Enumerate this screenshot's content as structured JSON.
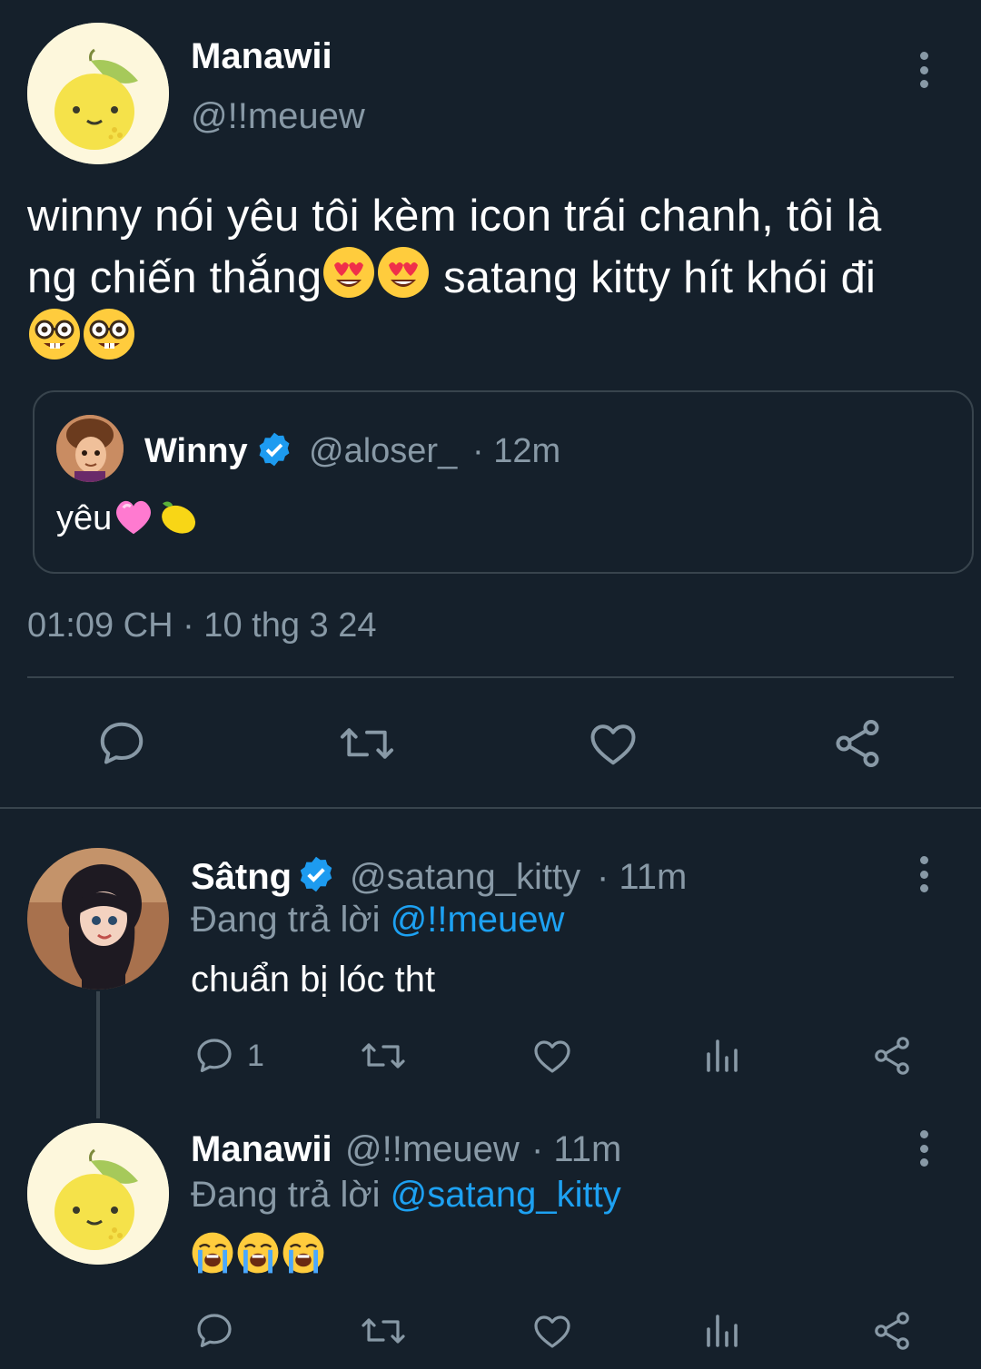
{
  "main_tweet": {
    "author_name": "Manawii",
    "author_handle": "@!!meuew",
    "text_line1": "winny nói yêu tôi kèm icon trái chanh, tôi là",
    "text_line2a": "ng chiến thắng",
    "text_line2b": " satang kitty hít khói đi",
    "timestamp": "01:09 CH · 10 thg 3 24",
    "avatar_icon": "lemon-avatar-icon",
    "emojis": [
      "heart-eyes-emoji",
      "heart-eyes-emoji",
      "nerd-face-emoji",
      "nerd-face-emoji"
    ]
  },
  "quoted_tweet": {
    "author_name": "Winny",
    "author_handle": "@aloser_",
    "time": "· 12m",
    "text": "yêu",
    "emojis": [
      "pink-heart-emoji",
      "lemon-emoji"
    ]
  },
  "actions": {
    "reply_icon": "reply-icon",
    "retweet_icon": "retweet-icon",
    "like_icon": "heart-icon",
    "share_icon": "share-icon",
    "views_icon": "bar-chart-icon"
  },
  "replies": [
    {
      "author_name": "Sâtng",
      "author_handle": "@satang_kitty",
      "time": "· 11m",
      "replying_prefix": "Đang trả lời ",
      "replying_to": "@!!meuew",
      "text": "chuẩn bị lóc tht",
      "reply_count": "1"
    },
    {
      "author_name": "Manawii",
      "author_handle": "@!!meuew",
      "time": "· 11m",
      "replying_prefix": "Đang trả lời ",
      "replying_to": "@satang_kitty",
      "text": "",
      "emojis": [
        "loudly-crying-emoji",
        "loudly-crying-emoji",
        "loudly-crying-emoji"
      ],
      "reply_count": ""
    }
  ],
  "colors": {
    "background": "#15202b",
    "border": "#38444d",
    "muted": "#8899a6",
    "link": "#1da1f2",
    "verified": "#1d9bf0"
  }
}
